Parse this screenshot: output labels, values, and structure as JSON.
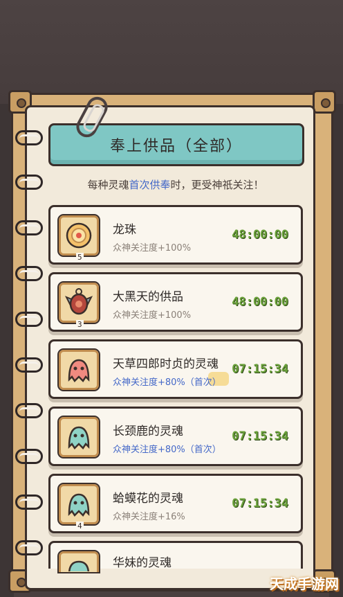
{
  "title": "奉上供品（全部）",
  "subtitle": {
    "prefix": "每种灵魂",
    "highlight": "首次供奉",
    "suffix": "时，更受神祇关注！"
  },
  "items": [
    {
      "name": "龙珠",
      "desc": "众神关注度+100%",
      "desc_style": "gray",
      "timer": "48:00:00",
      "badge": "5",
      "icon": "dragon-orb-icon"
    },
    {
      "name": "大黑天的供品",
      "desc": "众神关注度+100%",
      "desc_style": "gray",
      "timer": "48:00:00",
      "badge": "3",
      "icon": "amulet-icon"
    },
    {
      "name": "天草四郎时贞的灵魂",
      "desc": "众神关注度+80%（首次）",
      "desc_style": "blue",
      "timer": "07:15:34",
      "badge": "",
      "icon": "red-ghost-icon"
    },
    {
      "name": "长颈鹿的灵魂",
      "desc": "众神关注度+80%（首次）",
      "desc_style": "blue",
      "timer": "07:15:34",
      "badge": "",
      "icon": "teal-ghost-icon"
    },
    {
      "name": "蛤蟆花的灵魂",
      "desc": "众神关注度+16%",
      "desc_style": "gray",
      "timer": "07:15:34",
      "badge": "4",
      "icon": "teal-ghost-icon"
    },
    {
      "name": "华妹的灵魂",
      "desc": "",
      "desc_style": "gray",
      "timer": "",
      "badge": "",
      "icon": "teal-ghost-icon"
    }
  ],
  "watermark": "天成手游网",
  "colors": {
    "banner": "#7fc7c4",
    "timer": "#6aa13a",
    "highlight": "#4468c8",
    "paper": "#f2eadb",
    "frame": "#d9b27a"
  }
}
